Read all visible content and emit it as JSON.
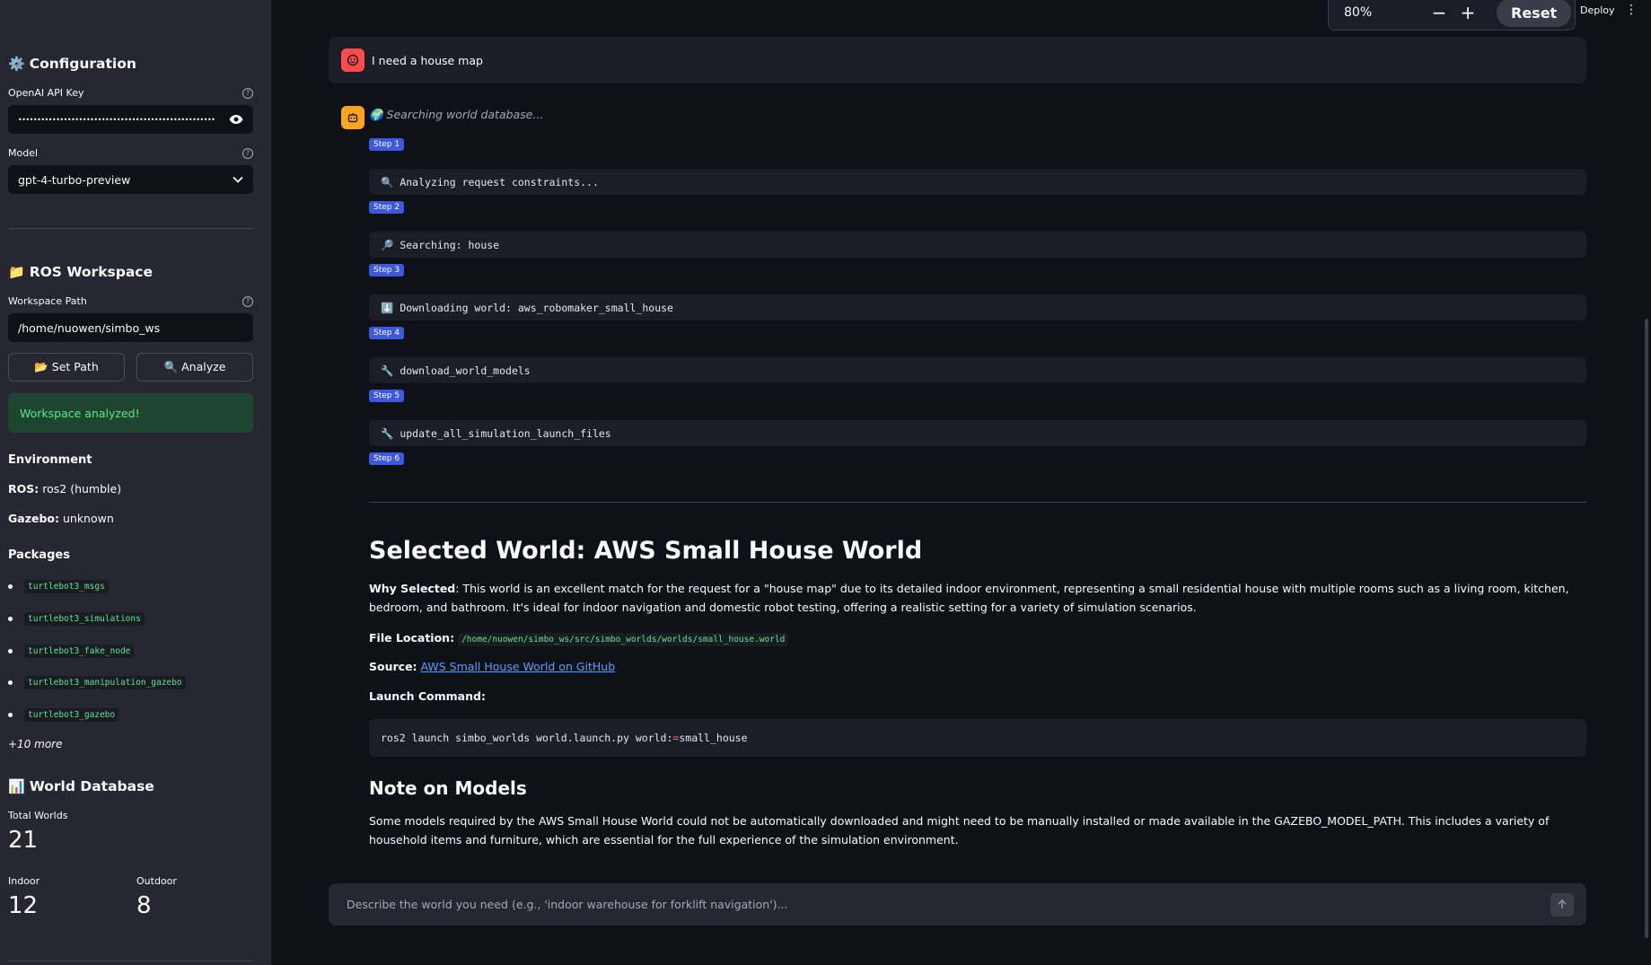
{
  "sidebar": {
    "config": {
      "icon": "⚙️",
      "title": "Configuration"
    },
    "api_key": {
      "label": "OpenAI API Key",
      "value": "••••••••••••••••••••••••••••••••••••••••••••••••••••"
    },
    "model": {
      "label": "Model",
      "value": "gpt-4-turbo-preview"
    },
    "ros": {
      "icon": "📁",
      "title": "ROS Workspace"
    },
    "workspace": {
      "label": "Workspace Path",
      "value": "/home/nuowen/simbo_ws"
    },
    "set_path_label": "📂 Set Path",
    "analyze_label": "🔍 Analyze",
    "success_text": "Workspace analyzed!",
    "env_title": "Environment",
    "ros_key": "ROS:",
    "ros_value": "ros2 (humble)",
    "gazebo_key": "Gazebo:",
    "gazebo_value": "unknown",
    "packages_title": "Packages",
    "packages": [
      "turtlebot3_msgs",
      "turtlebot3_simulations",
      "turtlebot3_fake_node",
      "turtlebot3_manipulation_gazebo",
      "turtlebot3_gazebo"
    ],
    "more_text": "+10 more",
    "world_db": {
      "icon": "📊",
      "title": "World Database"
    },
    "total_label": "Total Worlds",
    "total_value": "21",
    "indoor_label": "Indoor",
    "indoor_value": "12",
    "outdoor_label": "Outdoor",
    "outdoor_value": "8"
  },
  "toolbar": {
    "zoom": "80%",
    "minus": "−",
    "plus": "+",
    "reset": "Reset",
    "deploy": "Deploy",
    "menu": "⋮"
  },
  "chat": {
    "user_message": "I need a house map",
    "status": "🌍 Searching world database...",
    "steps": [
      {
        "label": "Step 1",
        "icon": "🔍",
        "text": "Analyzing request constraints..."
      },
      {
        "label": "Step 2",
        "icon": "🔎",
        "text": "Searching: house"
      },
      {
        "label": "Step 3",
        "icon": "⬇️",
        "text": "Downloading world: aws_robomaker_small_house"
      },
      {
        "label": "Step 4",
        "icon": "🔧",
        "text": "download_world_models"
      },
      {
        "label": "Step 5",
        "icon": "🔧",
        "text": "update_all_simulation_launch_files"
      },
      {
        "label": "Step 6"
      }
    ],
    "selected_title": "Selected World: AWS Small House World",
    "why_label": "Why Selected",
    "why_text": ": This world is an excellent match for the request for a \"house map\" due to its detailed indoor environment, representing a small residential house with multiple rooms such as a living room, kitchen, bedroom, and bathroom. It's ideal for indoor navigation and domestic robot testing, offering a realistic setting for a variety of simulation scenarios.",
    "file_label": "File Location:",
    "file_path": "/home/nuowen/simbo_ws/src/simbo_worlds/worlds/small_house.world",
    "source_label": "Source:",
    "source_link": "AWS Small House World on GitHub",
    "launch_label": "Launch Command",
    "launch_cmd_a": "ros2 launch simbo_worlds world.launch.py world:",
    "launch_cmd_eq": "=",
    "launch_cmd_b": "small_house",
    "note_title": "Note on Models",
    "note_text": "Some models required by the AWS Small House World could not be automatically downloaded and might need to be manually installed or made available in the GAZEBO_MODEL_PATH. This includes a variety of household items and furniture, which are essential for the full experience of the simulation environment.",
    "input_placeholder": "Describe the world you need (e.g., 'indoor warehouse for forklift navigation')..."
  }
}
